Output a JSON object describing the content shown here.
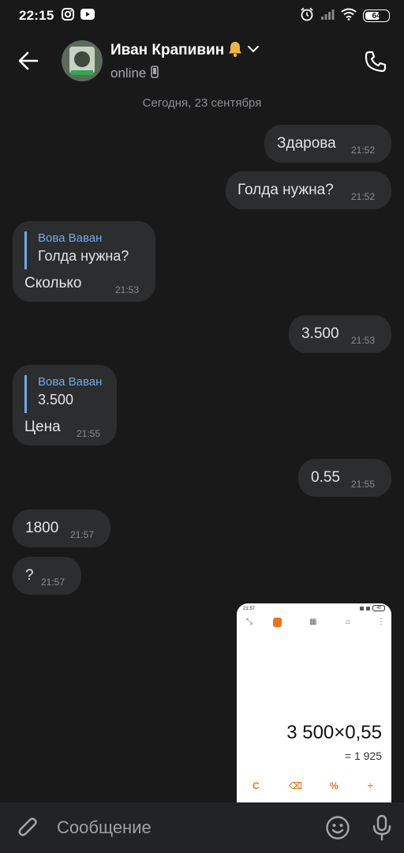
{
  "status_bar": {
    "time": "22:15",
    "battery": "64",
    "icons": [
      "instagram-icon",
      "youtube-icon",
      "alarm-icon",
      "signal-icon",
      "wifi-icon",
      "battery-icon"
    ]
  },
  "header": {
    "contact_name": "Иван Крапивин",
    "contact_status": "online",
    "icons": [
      "back-arrow-icon",
      "bell-icon",
      "chevron-down-icon",
      "mobile-device-icon",
      "phone-icon"
    ]
  },
  "date_separator": "Сегодня, 23 сентября",
  "messages": [
    {
      "text": "Здарова",
      "time": "21:52",
      "side": "outgoing"
    },
    {
      "text": "Голда нужна?",
      "time": "21:52",
      "side": "outgoing"
    },
    {
      "reply_author": "Вова Ваван",
      "reply_text": "Голда нужна?",
      "text": "Сколько",
      "time": "21:53",
      "side": "incoming"
    },
    {
      "text": "3.500",
      "time": "21:53",
      "side": "outgoing"
    },
    {
      "reply_author": "Вова Ваван",
      "reply_text": "3.500",
      "text": "Цена",
      "time": "21:55",
      "side": "incoming"
    },
    {
      "text": "0.55",
      "time": "21:55",
      "side": "outgoing"
    },
    {
      "text": "1800",
      "time": "21:57",
      "side": "incoming"
    },
    {
      "text": "?",
      "time": "21:57",
      "side": "incoming"
    }
  ],
  "attachment": {
    "mini_time": "21:57",
    "mini_battery": "48",
    "expression": "3 500×0,55",
    "result": "= 1 925",
    "keys": [
      "C",
      "⌫",
      "%",
      "÷"
    ]
  },
  "input_bar": {
    "placeholder": "Сообщение",
    "icons": [
      "paperclip-icon",
      "emoji-icon",
      "microphone-icon"
    ]
  },
  "colors": {
    "background": "#19191a",
    "bubble": "#2c2d2e",
    "accent": "#71aaeb",
    "calc_orange": "#f0701c"
  }
}
